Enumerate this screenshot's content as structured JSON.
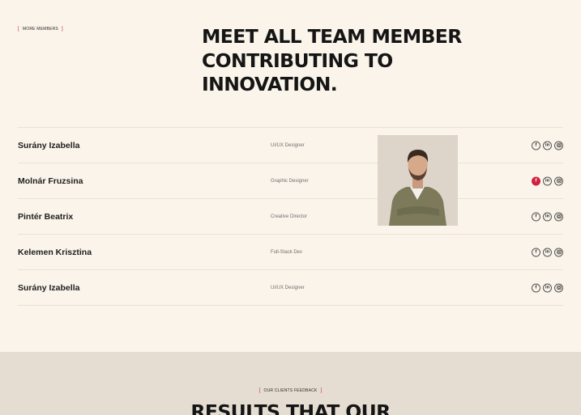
{
  "team_section": {
    "tag": "MORE MEMBERS",
    "headline_lines": [
      "MEET ALL TEAM MEMBER",
      "CONTRIBUTING TO",
      "INNOVATION."
    ],
    "members": [
      {
        "name": "Surány Izabella",
        "role": "UI/UX Designer"
      },
      {
        "name": "Molnár Fruzsina",
        "role": "Graphic Designer",
        "active": true
      },
      {
        "name": "Pintér Beatrix",
        "role": "Creative Director"
      },
      {
        "name": "Kelemen Krisztina",
        "role": "Full-Stack Dev"
      },
      {
        "name": "Surány Izabella",
        "role": "UI/UX Designer"
      }
    ],
    "social_icons": [
      "f",
      "in",
      "ig"
    ]
  },
  "feedback_section": {
    "tag": "OUR CLIENTS FEEDBACK",
    "title": "RESULTS THAT OUR"
  },
  "colors": {
    "background": "#faf4ea",
    "accent": "#d0213f",
    "feedback_background": "#e5ddd1"
  }
}
